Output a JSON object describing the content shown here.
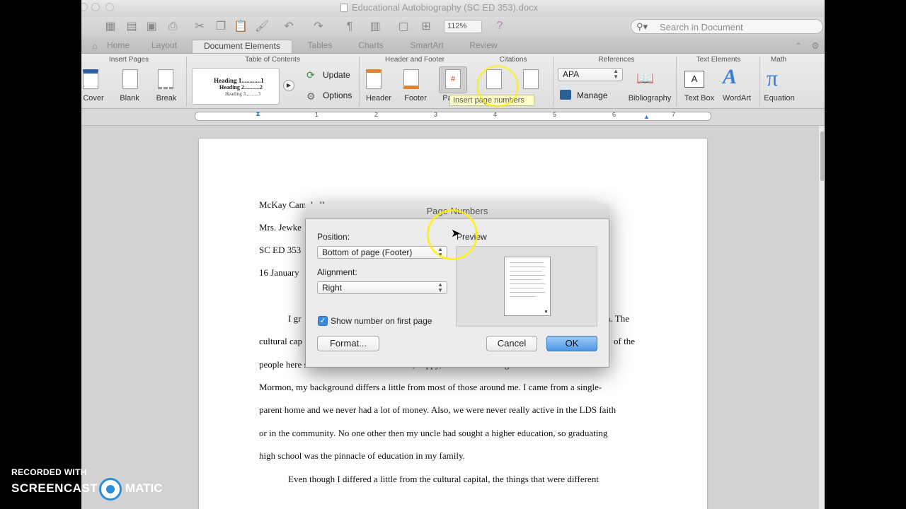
{
  "window": {
    "title": "Educational Autobiography (SC ED 353).docx"
  },
  "toolbar": {
    "zoom": "112%",
    "search_placeholder": "Search in Document"
  },
  "ribbon_tabs": [
    "Home",
    "Layout",
    "Document Elements",
    "Tables",
    "Charts",
    "SmartArt",
    "Review"
  ],
  "ribbon": {
    "groups": {
      "insert_pages": "Insert Pages",
      "toc": "Table of Contents",
      "header_footer": "Header and Footer",
      "citations": "Citations",
      "references": "References",
      "text_elements": "Text Elements",
      "math": "Math"
    },
    "buttons": {
      "cover": "Cover",
      "blank": "Blank",
      "break": "Break",
      "update": "Update",
      "options": "Options",
      "header": "Header",
      "footer": "Footer",
      "page_numbers": "Pa",
      "footnote": "Footnote",
      "endnote": "Endnote",
      "manage": "Manage",
      "bibliography": "Bibliography",
      "text_box": "Text Box",
      "wordart": "WordArt",
      "equation": "Equation"
    },
    "toc_preview": [
      "Heading 1............1",
      "Heading 2...........2",
      "Heading 3..........3"
    ],
    "citation_style": "APA",
    "tooltip": "Insert page numbers"
  },
  "ruler": {
    "numbers": [
      "1",
      "2",
      "3",
      "4",
      "5",
      "6",
      "7"
    ]
  },
  "document": {
    "lines": [
      "McKay Campbell",
      "Mrs. Jewke",
      "SC ED 353",
      "16 January",
      "I gr",
      "ea. The",
      "cultural cap",
      "of the",
      "people here seemed to be semi-successful, happy, and well meaning. While I am white and",
      "Mormon, my background differs a little from most of those around me. I came from a single-",
      "parent home and we never had a lot of money. Also, we were never really active in the LDS faith",
      "or in the community. No one other then my uncle had sought a higher education, so graduating",
      "high school was the pinnacle of education in my family.",
      "Even though I differed a little from the cultural capital, the things that were different"
    ]
  },
  "dialog": {
    "title": "Page Numbers",
    "position_label": "Position:",
    "position_value": "Bottom of page (Footer)",
    "alignment_label": "Alignment:",
    "alignment_value": "Right",
    "show_first_page": "Show number on first page",
    "show_first_page_checked": true,
    "preview_label": "Preview",
    "format_button": "Format...",
    "cancel_button": "Cancel",
    "ok_button": "OK"
  },
  "watermark": {
    "line1": "RECORDED WITH",
    "line2": "SCREENCAST",
    "line3": "MATIC"
  },
  "colors": {
    "accent": "#4e97e6",
    "highlight": "#fff000"
  }
}
